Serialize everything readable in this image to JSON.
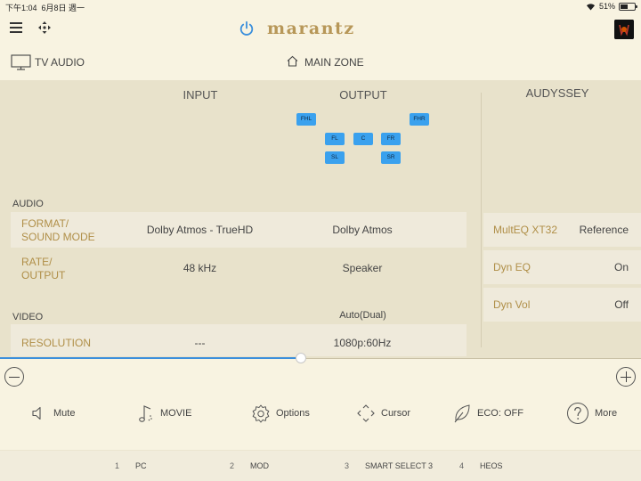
{
  "status_bar": {
    "time": "下午1:04",
    "date": "6月8日 週一",
    "battery": "51%",
    "battery_level": 0.51
  },
  "header": {
    "brand": "marantz"
  },
  "zone": {
    "source": "TV AUDIO",
    "zone_name": "MAIN ZONE"
  },
  "columns": {
    "input": "INPUT",
    "output": "OUTPUT",
    "audyssey": "AUDYSSEY"
  },
  "speakers": [
    "FHL",
    "FHR",
    "FL",
    "C",
    "FR",
    "SL",
    "SR"
  ],
  "audio": {
    "section": "AUDIO",
    "format_label_1": "FORMAT/",
    "format_label_2": "SOUND MODE",
    "format_input": "Dolby Atmos - TrueHD",
    "format_output": "Dolby Atmos",
    "rate_label_1": "RATE/",
    "rate_label_2": "OUTPUT",
    "rate_input": "48 kHz",
    "rate_output": "Speaker"
  },
  "video": {
    "section": "VIDEO",
    "output_mode": "Auto(Dual)",
    "resolution_label": "RESOLUTION",
    "resolution_input": "---",
    "resolution_output": "1080p:60Hz"
  },
  "audyssey": [
    {
      "label": "MultEQ XT32",
      "value": "Reference"
    },
    {
      "label": "Dyn EQ",
      "value": "On"
    },
    {
      "label": "Dyn Vol",
      "value": "Off"
    }
  ],
  "volume": {
    "level": 0.47
  },
  "controls": {
    "mute": "Mute",
    "movie": "MOVIE",
    "options": "Options",
    "cursor": "Cursor",
    "eco": "ECO: OFF",
    "more": "More"
  },
  "sources": [
    {
      "num": "1",
      "label": "PC"
    },
    {
      "num": "2",
      "label": "MOD"
    },
    {
      "num": "3",
      "label": "SMART SELECT 3"
    },
    {
      "num": "4",
      "label": "HEOS"
    }
  ],
  "colors": {
    "accent_blue": "#3b8fdc",
    "speaker_blue": "#3aa1ee",
    "gold": "#b79758",
    "label_gold": "#b08f48",
    "panel": "#e8e2cb",
    "background": "#f8f3e1"
  }
}
